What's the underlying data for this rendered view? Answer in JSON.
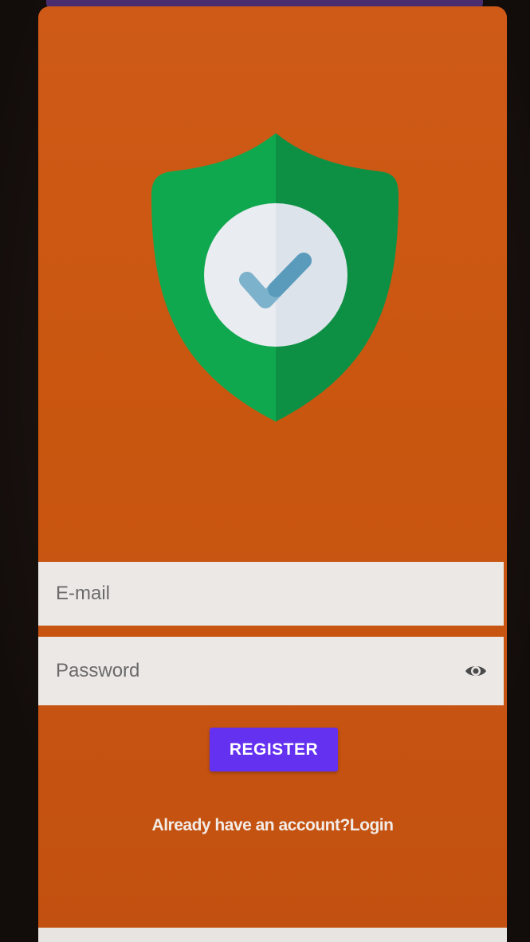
{
  "form": {
    "email_placeholder": "E-mail",
    "password_placeholder": "Password",
    "register_label": "REGISTER",
    "login_prompt": "Already have an account?Login"
  },
  "icons": {
    "logo": "shield-check-icon",
    "password_toggle": "eye-icon"
  },
  "colors": {
    "background": "#c9560f",
    "shield_light": "#10a84f",
    "shield_dark": "#0e9044",
    "check_circle": "#e9ecf0",
    "check_mark": "#6aa6c4",
    "button": "#6431f0",
    "input_background": "#ebe8e6"
  }
}
